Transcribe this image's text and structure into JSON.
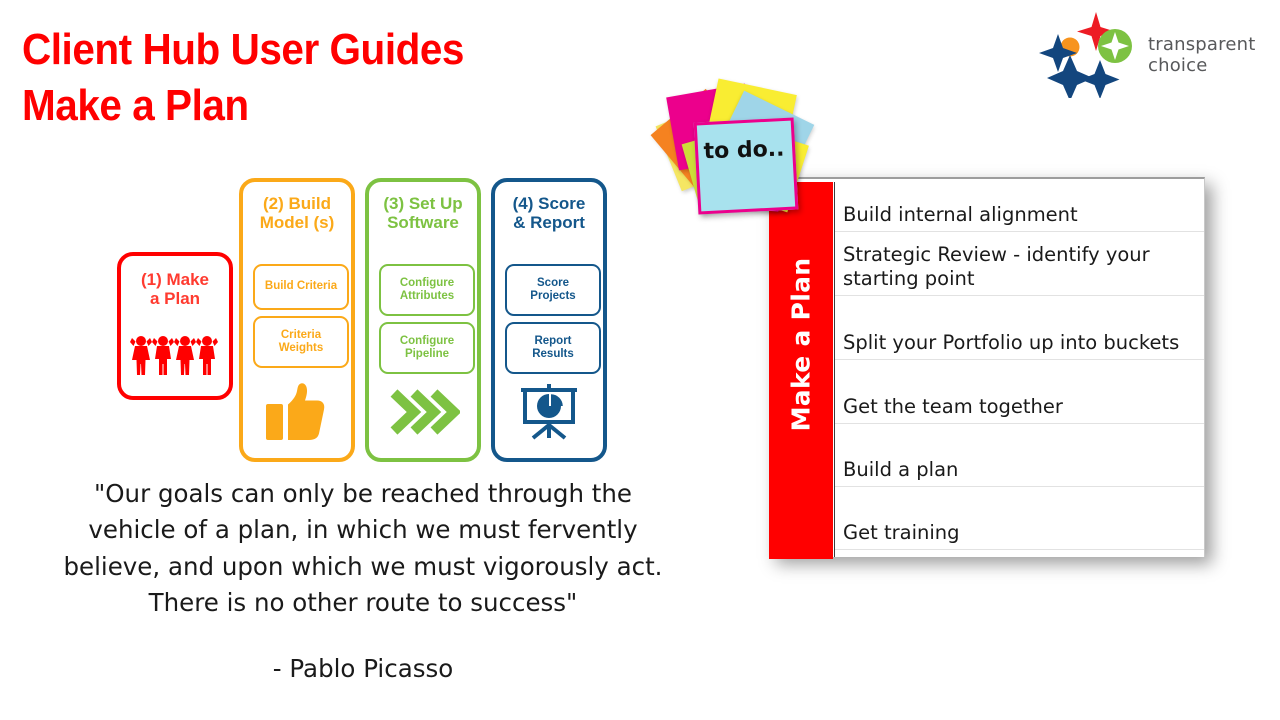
{
  "title": {
    "line1": "Client Hub User Guides",
    "line2": "Make a Plan",
    "color": "#FF0000"
  },
  "logo": {
    "name_line1": "transparent",
    "name_line2": "choice",
    "colors": {
      "red_star": "#ED1C24",
      "orange_dot": "#F7941E",
      "green_circle": "#7DC242",
      "navy": "#13467E",
      "text": "#58595B"
    }
  },
  "process": {
    "steps": [
      {
        "title": "(1) Make\na Plan",
        "title_l1": "(1) Make",
        "title_l2": "a Plan",
        "color": "#FF0000",
        "text_color": "#FF3B30",
        "icon": "people-raised-arms-icon",
        "subs": []
      },
      {
        "title_l1": "(2) Build",
        "title_l2": "Model (s)",
        "color": "#FBA919",
        "text_color": "#FBA919",
        "icon": "thumbs-up-icon",
        "subs": [
          "Build Criteria",
          "Criteria\nWeights"
        ],
        "sub1": "Build Criteria",
        "sub2_l1": "Criteria",
        "sub2_l2": "Weights"
      },
      {
        "title_l1": "(3) Set Up",
        "title_l2": "Software",
        "color": "#7DC242",
        "text_color": "#7DC242",
        "icon": "triple-chevron-right-icon",
        "sub1_l1": "Configure",
        "sub1_l2": "Attributes",
        "sub2_l1": "Configure",
        "sub2_l2": "Pipeline"
      },
      {
        "title_l1": "(4) Score",
        "title_l2": "& Report",
        "color": "#14578B",
        "text_color": "#14578B",
        "icon": "presentation-pie-chart-icon",
        "sub1_l1": "Score",
        "sub1_l2": "Projects",
        "sub2_l1": "Report",
        "sub2_l2": "Results"
      }
    ]
  },
  "quote": {
    "line1": "\"Our goals can only be reached through the",
    "line2": "vehicle of a plan, in which we must fervently",
    "line3": "believe, and upon which we must vigorously act.",
    "line4": "There is no other route to success\"",
    "author": "- Pablo Picasso"
  },
  "todo": {
    "sidebar_label": "Make a Plan",
    "sidebar_color": "#FF0000",
    "sticky_note_text": "to do..",
    "items": [
      {
        "line1": "Build internal alignment",
        "line2": ""
      },
      {
        "line1": "Strategic Review - identify your",
        "line2": "starting point"
      },
      {
        "line1": "Split your Portfolio up into buckets",
        "line2": ""
      },
      {
        "line1": "Get the team together",
        "line2": ""
      },
      {
        "line1": "Build a plan",
        "line2": ""
      },
      {
        "line1": "Get training",
        "line2": ""
      }
    ]
  }
}
